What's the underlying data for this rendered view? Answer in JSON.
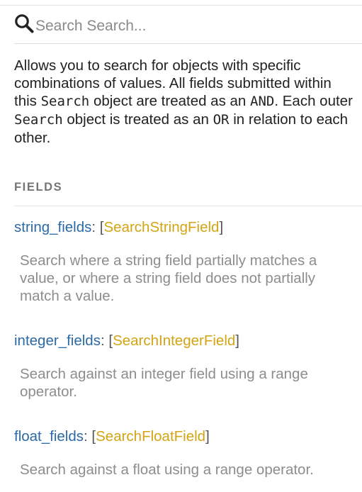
{
  "search": {
    "placeholder": "Search Search..."
  },
  "description": {
    "part1": "Allows you to search for objects with specific combinations of values. All fields submitted within this ",
    "code1": "Search",
    "part2": " object are treated as an ",
    "code2": "AND",
    "part3": ". Each outer ",
    "code3": "Search",
    "part4": " object is treated as an ",
    "code4": "OR",
    "part5": " in relation to each other."
  },
  "fields_heading": "FIELDS",
  "fields": [
    {
      "name": "string_fields",
      "colon": ": ",
      "open": "[",
      "type": "SearchStringField",
      "close": "]",
      "description": "Search where a string field partially matches a value, or where a string field does not partially match a value."
    },
    {
      "name": "integer_fields",
      "colon": ": ",
      "open": "[",
      "type": "SearchIntegerField",
      "close": "]",
      "description": "Search against an integer field using a range operator."
    },
    {
      "name": "float_fields",
      "colon": ": ",
      "open": "[",
      "type": "SearchFloatField",
      "close": "]",
      "description": "Search against a float using a range operator."
    }
  ],
  "colors": {
    "field_name": "#2b6aa6",
    "type_link": "#d3a414",
    "description_text": "#8d8d8d",
    "heading": "#757575"
  },
  "icons": {
    "search": "search-icon"
  }
}
